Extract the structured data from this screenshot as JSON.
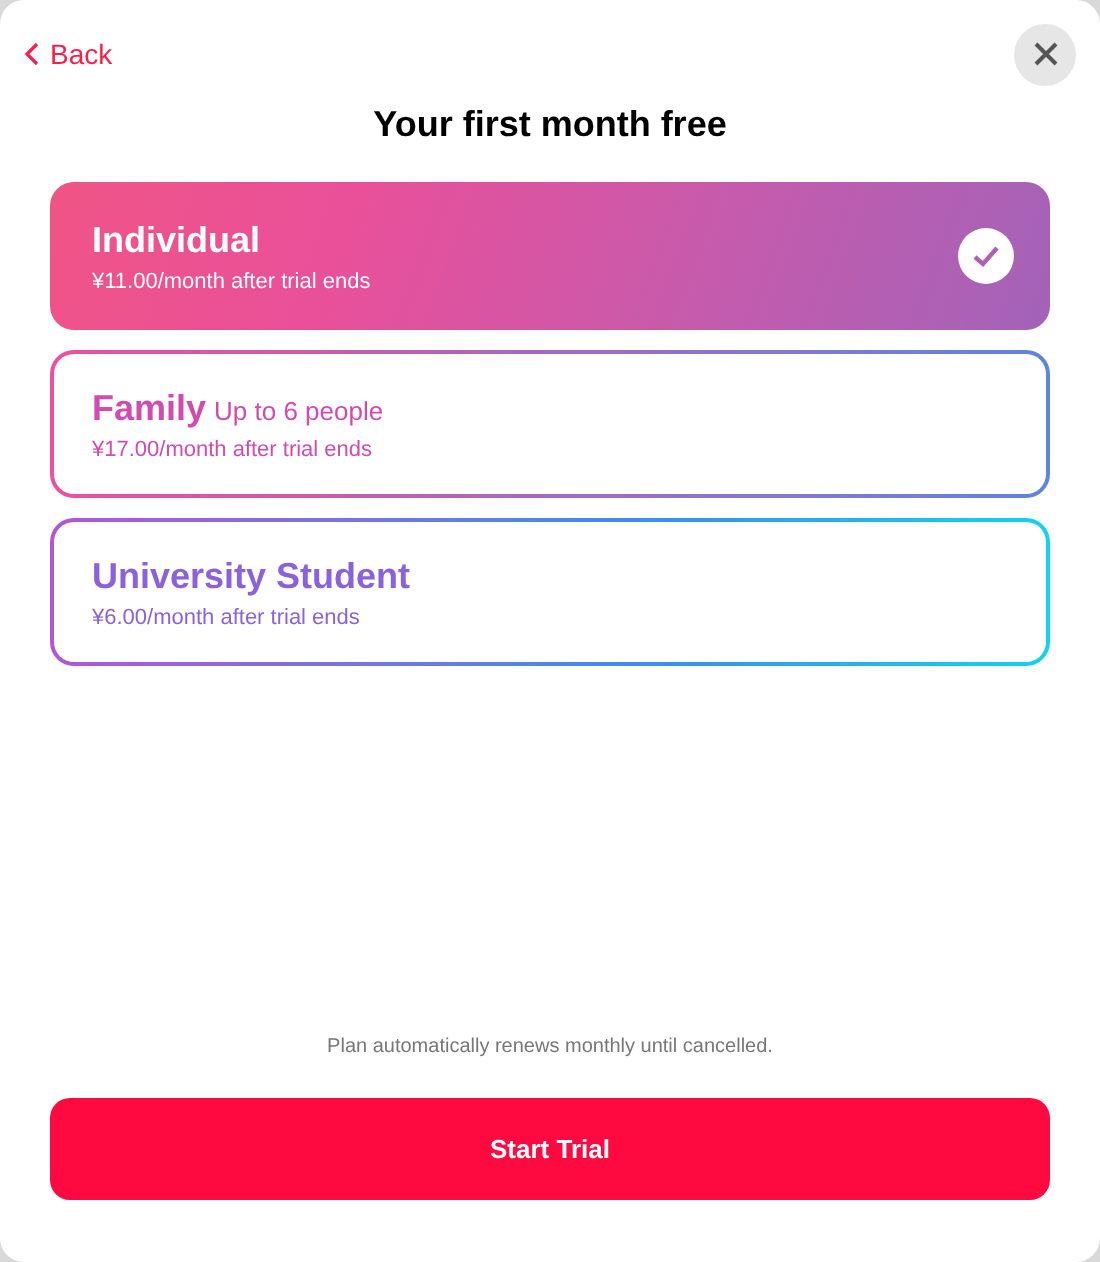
{
  "back": {
    "label": "Back"
  },
  "title": "Your first month free",
  "plans": [
    {
      "name": "Individual",
      "price": "¥11.00/month after trial ends",
      "selected": true
    },
    {
      "name": "Family",
      "note": "Up to 6 people",
      "price": "¥17.00/month after trial ends",
      "selected": false
    },
    {
      "name": "University Student",
      "price": "¥6.00/month after trial ends",
      "selected": false
    }
  ],
  "footnote": "Plan automatically renews monthly until cancelled.",
  "button": "Start Trial"
}
